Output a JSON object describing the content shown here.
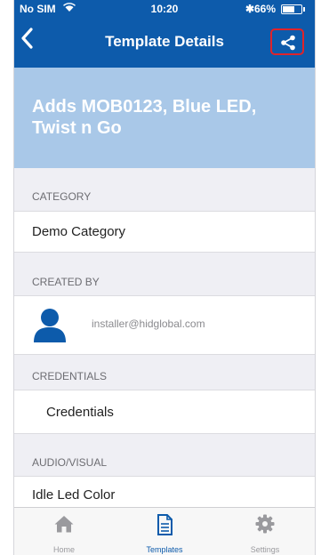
{
  "status_bar": {
    "carrier": "No SIM",
    "time": "10:20",
    "bluetooth_glyph": "✱",
    "battery": "66%",
    "battery_fraction": 0.66
  },
  "nav": {
    "title": "Template Details",
    "back_icon": "chevron-left-icon",
    "share_icon": "share-icon",
    "highlight_color": "#e0232a"
  },
  "template": {
    "name": "Adds MOB0123, Blue LED, Twist n Go"
  },
  "sections": {
    "category": {
      "header": "CATEGORY",
      "value": "Demo Category"
    },
    "created_by": {
      "header": "CREATED BY",
      "email": "installer@hidglobal.com"
    },
    "credentials": {
      "header": "CREDENTIALS",
      "value": "Credentials"
    },
    "audio_visual": {
      "header": "AUDIO/VISUAL",
      "value": "Idle Led Color"
    }
  },
  "tabs": [
    {
      "label": "Home",
      "icon": "home-icon",
      "active": false
    },
    {
      "label": "Templates",
      "icon": "document-icon",
      "active": true
    },
    {
      "label": "Settings",
      "icon": "gear-icon",
      "active": false
    }
  ],
  "colors": {
    "brand_blue": "#0d5bab",
    "banner_blue": "#a9c8e8",
    "background": "#efeff4"
  }
}
